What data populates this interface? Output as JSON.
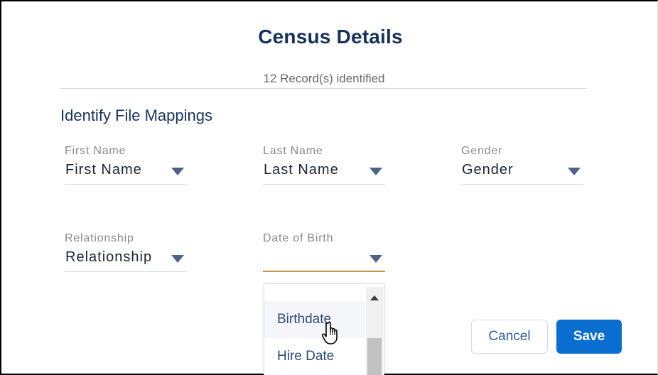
{
  "header": {
    "title": "Census Details",
    "records_text": "12 Record(s) identified"
  },
  "section": {
    "title": "Identify File Mappings"
  },
  "fields": [
    {
      "label": "First Name",
      "value": "First Name"
    },
    {
      "label": "Last Name",
      "value": "Last Name"
    },
    {
      "label": "Gender",
      "value": "Gender"
    },
    {
      "label": "Relationship",
      "value": "Relationship"
    },
    {
      "label": "Date of Birth",
      "value": ""
    }
  ],
  "dropdown": {
    "options": [
      "Birthdate",
      "Hire Date"
    ],
    "hovered": "Birthdate"
  },
  "buttons": {
    "cancel": "Cancel",
    "save": "Save"
  },
  "colors": {
    "title": "#16325c",
    "primary": "#0a6ed1",
    "active_underline": "#c7954a",
    "caret": "#4d6285"
  }
}
